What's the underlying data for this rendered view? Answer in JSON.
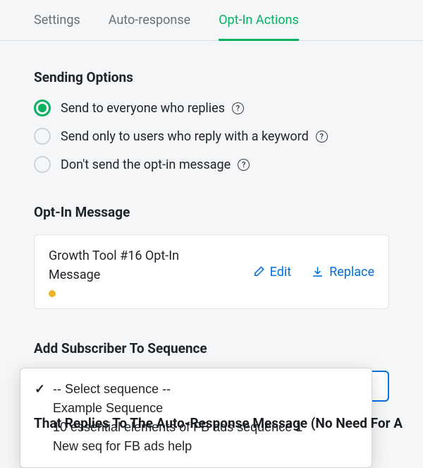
{
  "tabs": {
    "settings": "Settings",
    "autoResponse": "Auto-response",
    "optInActions": "Opt-In Actions",
    "active": "optInActions"
  },
  "sendingOptions": {
    "heading": "Sending Options",
    "selected": 0,
    "items": [
      "Send to everyone who replies",
      "Send only to users who reply with a keyword",
      "Don't send the opt-in message"
    ]
  },
  "optInMessage": {
    "heading": "Opt-In Message",
    "title": "Growth Tool #16 Opt-In Message",
    "status": "draft",
    "editLabel": "Edit",
    "replaceLabel": "Replace"
  },
  "sequence": {
    "heading": "Add Subscriber To Sequence",
    "selectedIndex": 0,
    "options": [
      "-- Select sequence --",
      "Example Sequence",
      "10 essential elements of FB ads sequence 1",
      "New seq for FB ads help"
    ]
  },
  "cutoffText": "That Replies To The Auto-Response Message (No Need For A"
}
